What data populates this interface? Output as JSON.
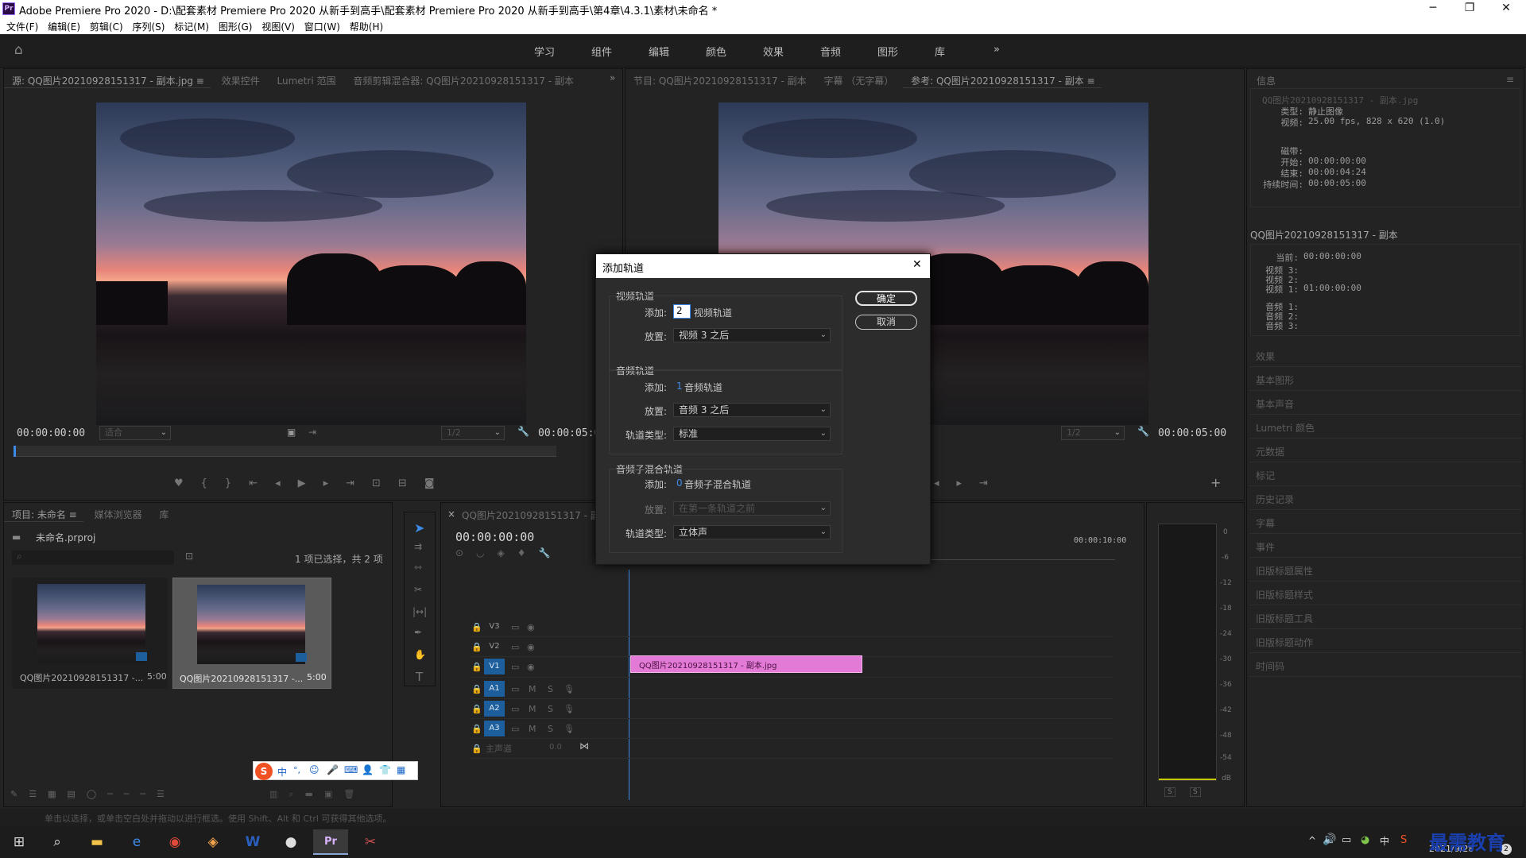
{
  "titlebar": {
    "logo": "Pr",
    "title": "Adobe Premiere Pro 2020 - D:\\配套素材 Premiere Pro 2020 从新手到高手\\配套素材 Premiere Pro 2020 从新手到高手\\第4章\\4.3.1\\素材\\未命名 *",
    "min": "─",
    "max": "❐",
    "close": "✕"
  },
  "menu": [
    "文件(F)",
    "编辑(E)",
    "剪辑(C)",
    "序列(S)",
    "标记(M)",
    "图形(G)",
    "视图(V)",
    "窗口(W)",
    "帮助(H)"
  ],
  "workspaces": [
    "学习",
    "组件",
    "编辑",
    "颜色",
    "效果",
    "音频",
    "图形",
    "库"
  ],
  "workspace_more": "»",
  "source_panel": {
    "tabs": [
      "源: QQ图片20210928151317 - 副本.jpg ≡",
      "效果控件",
      "Lumetri 范围",
      "音频剪辑混合器: QQ图片20210928151317 - 副本"
    ],
    "more": "»",
    "tc_left": "00:00:00:00",
    "fit": "适合",
    "ratio": "1/2",
    "tc_right": "00:00:05:00"
  },
  "program_panel": {
    "tabs": [
      "节目: QQ图片20210928151317 - 副本",
      "字幕 （无字幕）",
      "参考: QQ图片20210928151317 - 副本 ≡"
    ],
    "ratio": "1/2",
    "tc_right": "00:00:05:00",
    "add": "+"
  },
  "info_panel": {
    "tab": "信息",
    "menu": "≡",
    "file": "QQ图片20210928151317 - 副本.jpg",
    "type_label": "类型:",
    "type_value": "静止图像",
    "video_label": "视频:",
    "video_value": "25.00 fps, 828 x 620 (1.0)",
    "tape_label": "磁带:",
    "start_label": "开始:",
    "start_value": "00:00:00:00",
    "end_label": "结束:",
    "end_value": "00:00:04:24",
    "dur_label": "持续时间:",
    "dur_value": "00:00:05:00",
    "seq_name": "QQ图片20210928151317 - 副本",
    "cur_label": "当前:",
    "cur_value": "00:00:00:00",
    "v3": "视频 3:",
    "v2": "视频 2:",
    "v1": "视频 1:",
    "v1_value": "01:00:00:00",
    "a1": "音频 1:",
    "a2": "音频 2:",
    "a3": "音频 3:"
  },
  "right_panels": [
    "效果",
    "基本图形",
    "基本声音",
    "Lumetri 颜色",
    "元数据",
    "标记",
    "历史记录",
    "字幕",
    "事件",
    "旧版标题属性",
    "旧版标题样式",
    "旧版标题工具",
    "旧版标题动作",
    "时间码"
  ],
  "project_panel": {
    "tabs": [
      "项目: 未命名 ≡",
      "媒体浏览器",
      "库"
    ],
    "proj_file": "未命名.prproj",
    "selection": "1 项已选择，共 2 项",
    "items": [
      {
        "name": "QQ图片20210928151317 -...",
        "dur": "5:00"
      },
      {
        "name": "QQ图片20210928151317 -...",
        "dur": "5:00"
      }
    ]
  },
  "timeline": {
    "tab": "QQ图片20210928151317 - 副本",
    "close": "×",
    "timecode": "00:00:00:00",
    "ruler": "00:00:10:00",
    "tracks_video": [
      "V3",
      "V2",
      "V1"
    ],
    "tracks_audio": [
      "A1",
      "A2",
      "A3"
    ],
    "master": "主声道",
    "master_val": "0.0",
    "clip": "QQ图片20210928151317 - 副本.jpg",
    "m": "M",
    "s": "S"
  },
  "meter": {
    "ticks": [
      "0",
      "-6",
      "-12",
      "-18",
      "-24",
      "-30",
      "-36",
      "-42",
      "-48",
      "-54",
      "dB"
    ],
    "s1": "S",
    "s2": "S"
  },
  "dialog": {
    "title": "添加轨道",
    "close": "✕",
    "ok": "确定",
    "cancel": "取消",
    "video": {
      "group": "视频轨道",
      "add_label": "添加:",
      "add_value": "2",
      "add_suffix": "视频轨道",
      "place_label": "放置:",
      "place_value": "视频 3 之后"
    },
    "audio": {
      "group": "音频轨道",
      "add_label": "添加:",
      "add_value": "1",
      "add_suffix": "音频轨道",
      "place_label": "放置:",
      "place_value": "音频 3 之后",
      "type_label": "轨道类型:",
      "type_value": "标准"
    },
    "submix": {
      "group": "音频子混合轨道",
      "add_label": "添加:",
      "add_value": "0",
      "add_suffix": "音频子混合轨道",
      "place_label": "放置:",
      "place_value": "在第一条轨道之前",
      "type_label": "轨道类型:",
      "type_value": "立体声"
    }
  },
  "statusbar": "单击以选择，或单击空白处并拖动以进行框选。使用 Shift、Alt 和 Ctrl 可获得其他选项。",
  "ime": [
    "中",
    "°,",
    "☺",
    "🎤",
    "⌨",
    "👤",
    "👕",
    "▦"
  ],
  "watermark": "最需教育",
  "tray": {
    "date": "2021/9/28",
    "arrow": "^",
    "vol": "🔊",
    "ime": "中",
    "badge": "2"
  }
}
